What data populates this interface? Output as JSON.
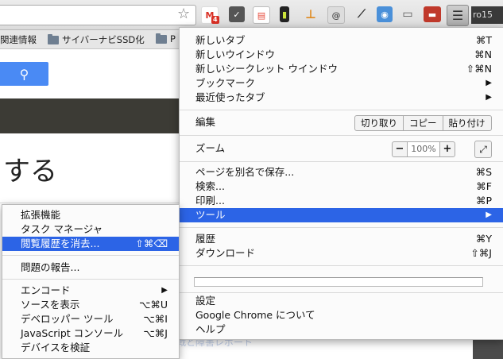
{
  "browser": {
    "extensions": [
      {
        "icon": "gmail-icon",
        "badge": "4",
        "color": "#d93025"
      },
      {
        "icon": "pocket-icon",
        "color": "#444444"
      },
      {
        "icon": "evernote-icon",
        "color": "#e74c3c"
      },
      {
        "icon": "battery-icon",
        "color": "#222222"
      },
      {
        "icon": "tool-icon",
        "color": "#e08a1e"
      },
      {
        "icon": "at-sign-icon",
        "color": "#777777"
      },
      {
        "icon": "eyedropper-icon",
        "color": "#333333"
      },
      {
        "icon": "camera-icon",
        "color": "#4a90d9"
      },
      {
        "icon": "cast-icon",
        "color": "#555555"
      },
      {
        "icon": "incognito-icon",
        "color": "#c0392b"
      }
    ],
    "profile_text": "ro15",
    "bookmarks": [
      "関連情報",
      "サイバーナビSSD化",
      "P"
    ]
  },
  "page": {
    "heading": "する",
    "link_text": "戦と障害レポート"
  },
  "menu": {
    "new_tab": {
      "label": "新しいタブ",
      "shortcut": "⌘T"
    },
    "new_window": {
      "label": "新しいウインドウ",
      "shortcut": "⌘N"
    },
    "new_incognito": {
      "label": "新しいシークレット ウインドウ",
      "shortcut": "⇧⌘N"
    },
    "bookmarks": {
      "label": "ブックマーク"
    },
    "recent_tabs": {
      "label": "最近使ったタブ"
    },
    "edit": {
      "label": "編集",
      "cut": "切り取り",
      "copy": "コピー",
      "paste": "貼り付け"
    },
    "zoom": {
      "label": "ズーム",
      "minus": "−",
      "value": "100%",
      "plus": "+"
    },
    "save_as": {
      "label": "ページを別名で保存...",
      "shortcut": "⌘S"
    },
    "find": {
      "label": "検索...",
      "shortcut": "⌘F"
    },
    "print": {
      "label": "印刷...",
      "shortcut": "⌘P"
    },
    "tools": {
      "label": "ツール"
    },
    "history": {
      "label": "履歴",
      "shortcut": "⌘Y"
    },
    "downloads": {
      "label": "ダウンロード",
      "shortcut": "⇧⌘J"
    },
    "settings": {
      "label": "設定"
    },
    "about": {
      "label": "Google Chrome について"
    },
    "help": {
      "label": "ヘルプ"
    }
  },
  "submenu": {
    "extensions": {
      "label": "拡張機能"
    },
    "task_manager": {
      "label": "タスク マネージャ"
    },
    "clear_history": {
      "label": "閲覧履歴を消去...",
      "shortcut": "⇧⌘⌫"
    },
    "report_issue": {
      "label": "問題の報告..."
    },
    "encoding": {
      "label": "エンコード"
    },
    "view_source": {
      "label": "ソースを表示",
      "shortcut": "⌥⌘U"
    },
    "developer_tools": {
      "label": "デベロッパー ツール",
      "shortcut": "⌥⌘I"
    },
    "js_console": {
      "label": "JavaScript コンソール",
      "shortcut": "⌥⌘J"
    },
    "inspect_devices": {
      "label": "デバイスを検証"
    }
  }
}
